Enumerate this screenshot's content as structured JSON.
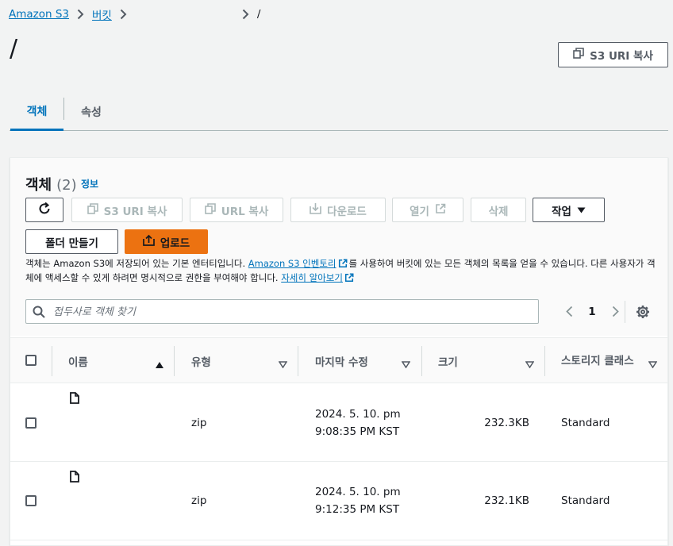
{
  "breadcrumb": {
    "root": "Amazon S3",
    "buckets": "버킷",
    "current": "/"
  },
  "page": {
    "title": "/",
    "copy_uri_label": "S3 URI 복사"
  },
  "tabs": [
    {
      "label": "객체",
      "active": true
    },
    {
      "label": "속성",
      "active": false
    }
  ],
  "objects_panel": {
    "title": "객체",
    "count": "(2)",
    "info": "정보",
    "buttons": {
      "refresh": "refresh",
      "copy_s3_uri": "S3 URI 복사",
      "copy_url": "URL 복사",
      "download": "다운로드",
      "open": "열기",
      "delete": "삭제",
      "actions": "작업",
      "create_folder": "폴더 만들기",
      "upload": "업로드"
    },
    "description": {
      "part1": "객체는 Amazon S3에 저장되어 있는 기본 엔터티입니다.",
      "inventory_link": "Amazon S3 인벤토리",
      "part2": "를 사용하여 버킷에 있는 모든 객체의 목록을 얻을 수 있습니다. 다른 사용자가 객체에 액세스할 수 있게 하려면 명시적으로 권한을 부여해야 합니다.",
      "learn_more": "자세히 알아보기"
    },
    "search_placeholder": "접두사로 객체 찾기",
    "pagination": {
      "page": "1"
    },
    "columns": {
      "name": "이름",
      "type": "유형",
      "modified": "마지막 수정",
      "size": "크기",
      "storage": "스토리지 클래스"
    },
    "rows": [
      {
        "name": "",
        "type": "zip",
        "modified_date": "2024. 5. 10. pm",
        "modified_time": "9:08:35 PM KST",
        "size": "232.3KB",
        "storage": "Standard"
      },
      {
        "name": "",
        "type": "zip",
        "modified_date": "2024. 5. 10. pm",
        "modified_time": "9:12:35 PM KST",
        "size": "232.1KB",
        "storage": "Standard"
      }
    ]
  },
  "colors": {
    "link": "#0073bb",
    "primary": "#ec7211",
    "text": "#16191f",
    "muted": "#545b64"
  },
  "icons": [
    "chevron-right-icon",
    "copy-icon",
    "refresh-icon",
    "download-icon",
    "external-link-icon",
    "caret-down-icon",
    "upload-icon",
    "search-icon",
    "chevron-left-icon",
    "gear-icon",
    "sort-up-icon",
    "sort-down-icon",
    "file-icon"
  ]
}
